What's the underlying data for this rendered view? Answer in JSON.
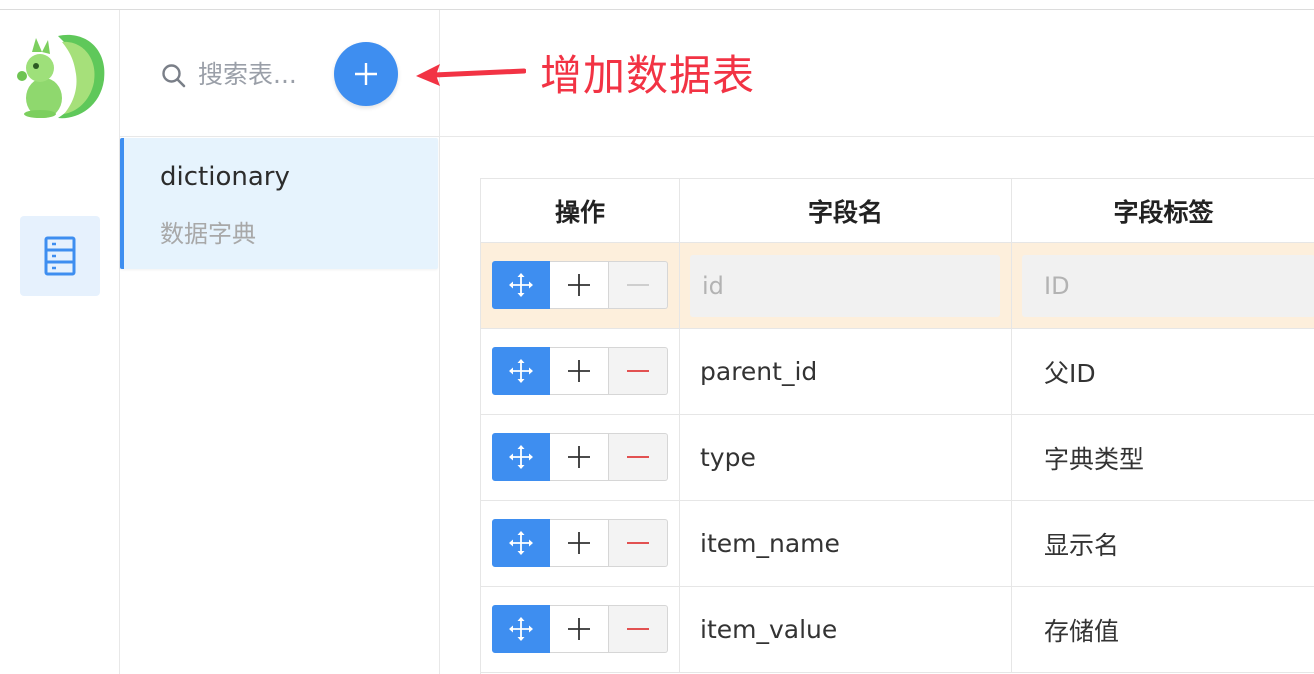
{
  "sidebar": {
    "logo_icon": "squirrel-logo-icon",
    "items": [
      {
        "icon": "database-table-icon",
        "active": true
      }
    ]
  },
  "table_list": {
    "search": {
      "placeholder": "搜索表..."
    },
    "add_button": {
      "icon": "plus-icon"
    },
    "tables": [
      {
        "name": "dictionary",
        "description": "数据字典",
        "selected": true
      }
    ]
  },
  "annotation": {
    "text": "增加数据表",
    "color": "#f23344"
  },
  "fields_table": {
    "headers": [
      "操作",
      "字段名",
      "字段标签"
    ],
    "rows": [
      {
        "name": "",
        "name_placeholder": "id",
        "label": "",
        "label_placeholder": "ID",
        "editable": true,
        "delete_enabled": false
      },
      {
        "name": "parent_id",
        "label": "父ID",
        "editable": false,
        "delete_enabled": true
      },
      {
        "name": "type",
        "label": "字典类型",
        "editable": false,
        "delete_enabled": true
      },
      {
        "name": "item_name",
        "label": "显示名",
        "editable": false,
        "delete_enabled": true
      },
      {
        "name": "item_value",
        "label": "存储值",
        "editable": false,
        "delete_enabled": true
      }
    ],
    "operation_icons": [
      "move-icon",
      "plus-icon",
      "minus-icon"
    ]
  },
  "colors": {
    "accent": "#3e8ef0",
    "selected_row": "#fdefdc",
    "selected_table": "#e6f3fd",
    "delete_red": "#e03a3a",
    "annotation_red": "#f23344"
  }
}
